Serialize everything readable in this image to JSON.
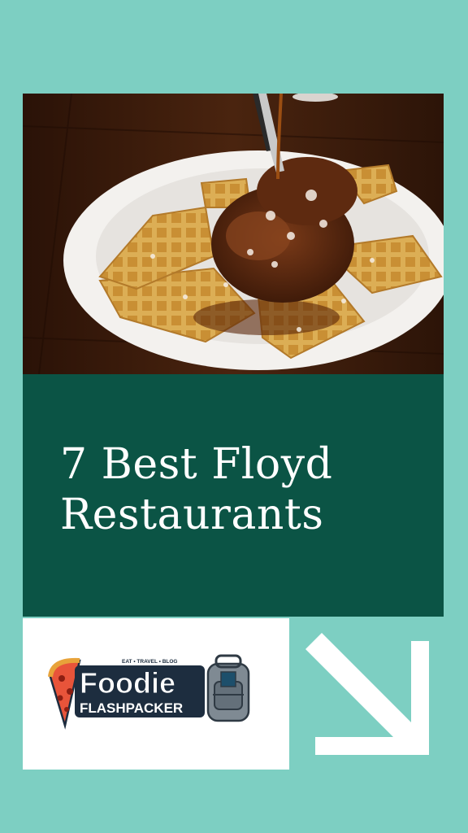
{
  "article": {
    "title_line1": "7 Best Floyd",
    "title_line2": "Restaurants"
  },
  "hero_image": {
    "subject": "chicken and waffles drizzled with syrup on a white plate"
  },
  "brand": {
    "name_top": "Foodie",
    "name_bottom": "FLASHPACKER",
    "tagline": "EAT • TRAVEL • BLOG"
  },
  "icons": {
    "arrow": "arrow-down-right-icon",
    "pizza": "pizza-icon",
    "backpack": "backpack-icon"
  },
  "colors": {
    "background": "#7dcfc2",
    "title_panel": "#0b5445",
    "title_text": "#ffffff",
    "arrow": "#ffffff"
  }
}
